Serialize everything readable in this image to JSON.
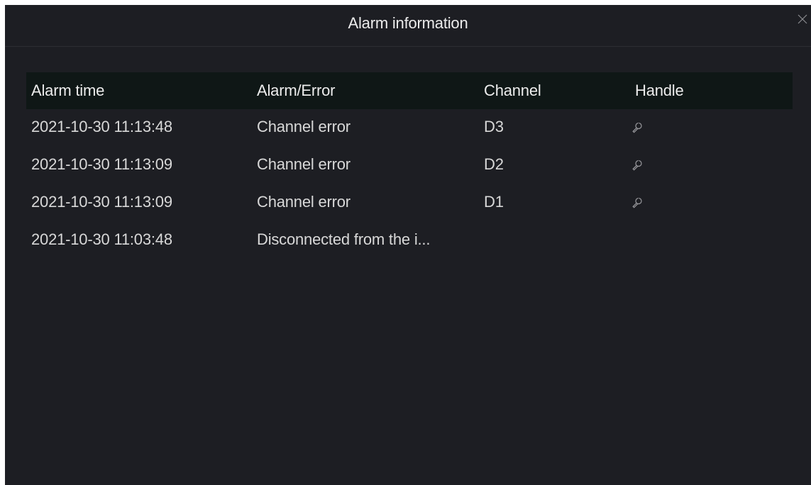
{
  "dialog": {
    "title": "Alarm information",
    "close_icon": "close-icon"
  },
  "table": {
    "headers": {
      "time": "Alarm time",
      "type": "Alarm/Error",
      "channel": "Channel",
      "handle": "Handle"
    },
    "rows": [
      {
        "time": "2021-10-30 11:13:48",
        "type": "Channel error",
        "channel": "D3",
        "handle_icon": "wrench-icon"
      },
      {
        "time": "2021-10-30 11:13:09",
        "type": "Channel error",
        "channel": "D2",
        "handle_icon": "wrench-icon"
      },
      {
        "time": "2021-10-30 11:13:09",
        "type": "Channel error",
        "channel": "D1",
        "handle_icon": "wrench-icon"
      },
      {
        "time": "2021-10-30 11:03:48",
        "type": "Disconnected from the i...",
        "channel": "",
        "handle_icon": ""
      }
    ]
  },
  "colors": {
    "background": "#1d1e23",
    "header_background": "#0f1716",
    "text": "#d8d8d8"
  }
}
